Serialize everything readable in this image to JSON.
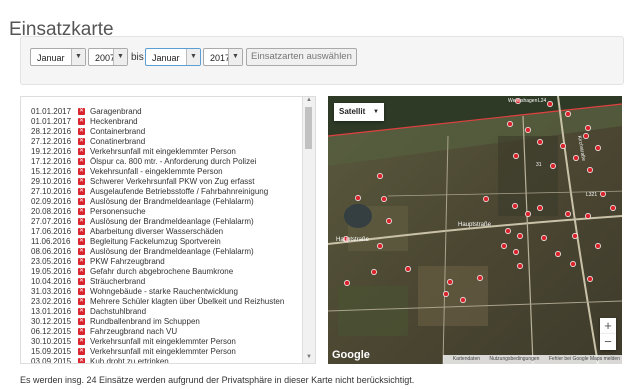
{
  "page": {
    "title": "Einsatzkarte"
  },
  "filter": {
    "from_month": "Januar",
    "from_year": "2007",
    "separator": "bis",
    "to_month": "Januar",
    "to_year": "2017",
    "submit_label": "Einsatzarten auswählen"
  },
  "incidents": [
    {
      "date": "01.01.2017",
      "type": "Garagenbrand"
    },
    {
      "date": "01.01.2017",
      "type": "Heckenbrand"
    },
    {
      "date": "28.12.2016",
      "type": "Containerbrand"
    },
    {
      "date": "27.12.2016",
      "type": "Conatinerbrand"
    },
    {
      "date": "19.12.2016",
      "type": "Verkehrsunfall mit eingeklemmter Person"
    },
    {
      "date": "17.12.2016",
      "type": "Ölspur ca. 800 mtr. - Anforderung durch Polizei"
    },
    {
      "date": "15.12.2016",
      "type": "Vekehrsunfall - eingeklemmte Person"
    },
    {
      "date": "29.10.2016",
      "type": "Schwerer Verkehrsunfall PKW von Zug erfasst"
    },
    {
      "date": "27.10.2016",
      "type": "Ausgelaufende Betriebsstoffe / Fahrbahnreinigung"
    },
    {
      "date": "02.09.2016",
      "type": "Auslösung der Brandmeldeanlage (Fehlalarm)"
    },
    {
      "date": "20.08.2016",
      "type": "Personensuche"
    },
    {
      "date": "27.07.2016",
      "type": "Auslösung der Brandmeldeanlage (Fehlalarm)"
    },
    {
      "date": "17.06.2016",
      "type": "Abarbeitung diverser Wasserschäden"
    },
    {
      "date": "11.06.2016",
      "type": "Begleitung Fackelumzug Sportverein"
    },
    {
      "date": "08.06.2016",
      "type": "Auslösung der Brandmeldeanlage (Fehlalarm)"
    },
    {
      "date": "23.05.2016",
      "type": "PKW Fahrzeugbrand"
    },
    {
      "date": "19.05.2016",
      "type": "Gefahr durch abgebrochene Baumkrone"
    },
    {
      "date": "10.04.2016",
      "type": "Sträucherbrand"
    },
    {
      "date": "31.03.2016",
      "type": "Wohngebäude - starke Rauchentwicklung"
    },
    {
      "date": "23.02.2016",
      "type": "Mehrere Schüler klagten über Übelkeit und Reizhusten"
    },
    {
      "date": "13.01.2016",
      "type": "Dachstuhlbrand"
    },
    {
      "date": "30.12.2015",
      "type": "Rundballenbrand im Schuppen"
    },
    {
      "date": "06.12.2015",
      "type": "Fahrzeugbrand nach VU"
    },
    {
      "date": "30.10.2015",
      "type": "Verkehrsunfall mit eingeklemmter Person"
    },
    {
      "date": "15.09.2015",
      "type": "Verkehrsunfall mit eingeklemmter Person"
    },
    {
      "date": "03.09.2015",
      "type": "Kuh droht zu ertrinken"
    }
  ],
  "map": {
    "type_label": "Satellit",
    "zoom_in": "+",
    "zoom_out": "−",
    "logo": "Google",
    "attribution_data": "Kartendaten",
    "attribution_terms": "Nutzungsbedingungen",
    "attribution_report": "Fehler bei Google Maps melden",
    "street_labels": [
      "Hauptstraße",
      "Hauptstraße",
      "Weiershagen",
      "Kirchstraße"
    ],
    "road_numbers": [
      "L24",
      "31",
      "L321"
    ]
  },
  "footer": {
    "note": "Es werden insg. 24 Einsätze werden aufgrund der Privatsphäre in dieser Karte nicht berücksichtigt."
  },
  "colors": {
    "accent": "#d9232d",
    "active_border": "#5a9fd4"
  },
  "icons": {
    "incident": "incident-marker-icon",
    "dropdown": "chevron-down-icon"
  }
}
